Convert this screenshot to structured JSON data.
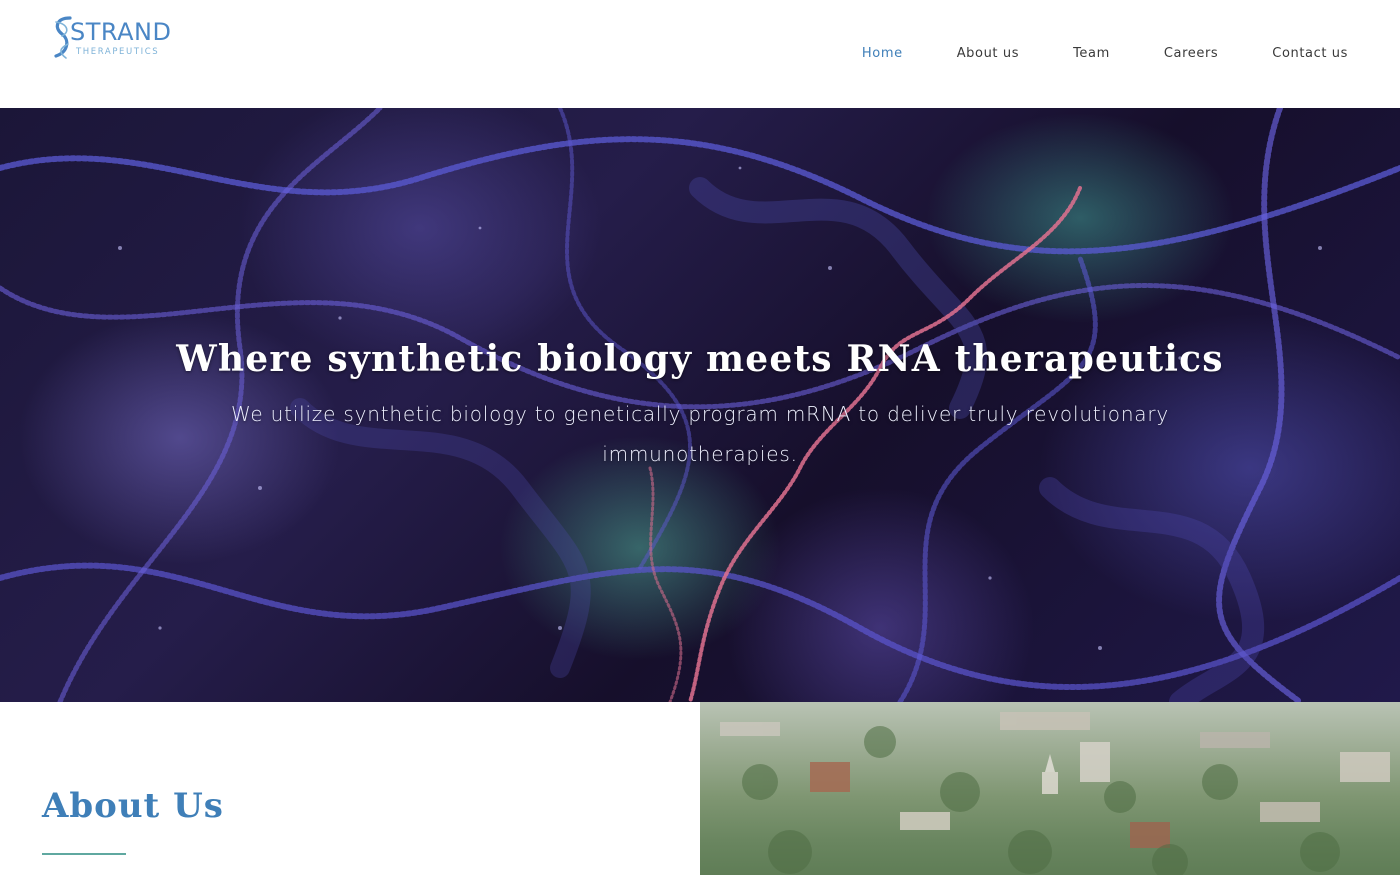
{
  "brand": {
    "name": "STRAND",
    "subtitle": "THERAPEUTICS",
    "primary_color": "#3f7fb8",
    "accent_color": "#5fa8a0"
  },
  "nav": {
    "items": [
      {
        "label": "Home",
        "active": true
      },
      {
        "label": "About us",
        "active": false
      },
      {
        "label": "Team",
        "active": false
      },
      {
        "label": "Careers",
        "active": false
      },
      {
        "label": "Contact us",
        "active": false
      }
    ]
  },
  "hero": {
    "title": "Where synthetic biology meets RNA therapeutics",
    "subtitle": "We utilize synthetic biology to genetically program mRNA to deliver truly revolutionary immunotherapies."
  },
  "about": {
    "title": "About Us"
  },
  "icons": {
    "logo": "dna-helix-icon"
  }
}
